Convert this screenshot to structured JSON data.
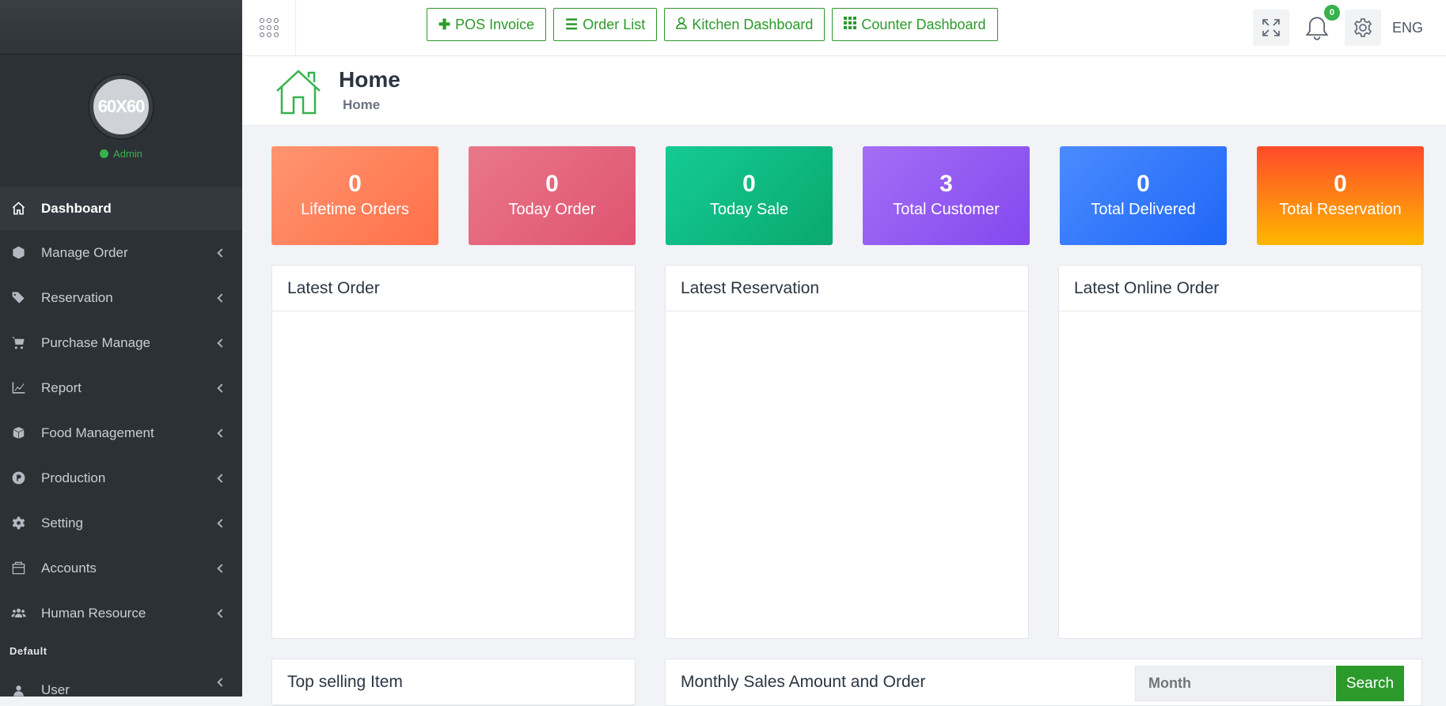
{
  "sidebar": {
    "avatar_text": "60X60",
    "role": "Admin",
    "items": [
      {
        "label": "Dashboard",
        "icon": "home-icon"
      },
      {
        "label": "Manage Order",
        "icon": "cube-icon"
      },
      {
        "label": "Reservation",
        "icon": "tags-icon"
      },
      {
        "label": "Purchase Manage",
        "icon": "cart-icon"
      },
      {
        "label": "Report",
        "icon": "chart-line-icon"
      },
      {
        "label": "Food Management",
        "icon": "box-icon"
      },
      {
        "label": "Production",
        "icon": "p-circle-icon"
      },
      {
        "label": "Setting",
        "icon": "gear-icon"
      },
      {
        "label": "Accounts",
        "icon": "bank-icon"
      },
      {
        "label": "Human Resource",
        "icon": "users-icon"
      }
    ],
    "section_default": "Default",
    "user_label": "User"
  },
  "topbar": {
    "buttons": [
      {
        "label": "POS Invoice",
        "icon": "plus-icon"
      },
      {
        "label": "Order List",
        "icon": "list-icon"
      },
      {
        "label": "Kitchen Dashboard",
        "icon": "user-icon"
      },
      {
        "label": "Counter Dashboard",
        "icon": "grid-icon"
      }
    ],
    "notification_count": "0",
    "language": "ENG"
  },
  "page": {
    "title": "Home",
    "breadcrumb": "Home"
  },
  "stats": [
    {
      "value": "0",
      "label": "Lifetime Orders",
      "color": "#ff7e58"
    },
    {
      "value": "0",
      "label": "Today Order",
      "color": "#e3637b"
    },
    {
      "value": "0",
      "label": "Today Sale",
      "color": "#0fba80"
    },
    {
      "value": "3",
      "label": "Total Customer",
      "color": "#945bf2"
    },
    {
      "value": "0",
      "label": "Total Delivered",
      "color": "#3478fb"
    },
    {
      "value": "0",
      "label": "Total Reservation",
      "color": "#ff6a1f"
    }
  ],
  "panels": {
    "latest_order": "Latest Order",
    "latest_reservation": "Latest Reservation",
    "latest_online_order": "Latest Online Order",
    "top_selling": "Top selling Item",
    "monthly_sales": "Monthly Sales Amount and Order"
  },
  "monthly_filter": {
    "placeholder": "Month",
    "search_label": "Search"
  },
  "colors": {
    "accent": "#2b9a2b",
    "sidebar_bg": "#2c3136"
  }
}
